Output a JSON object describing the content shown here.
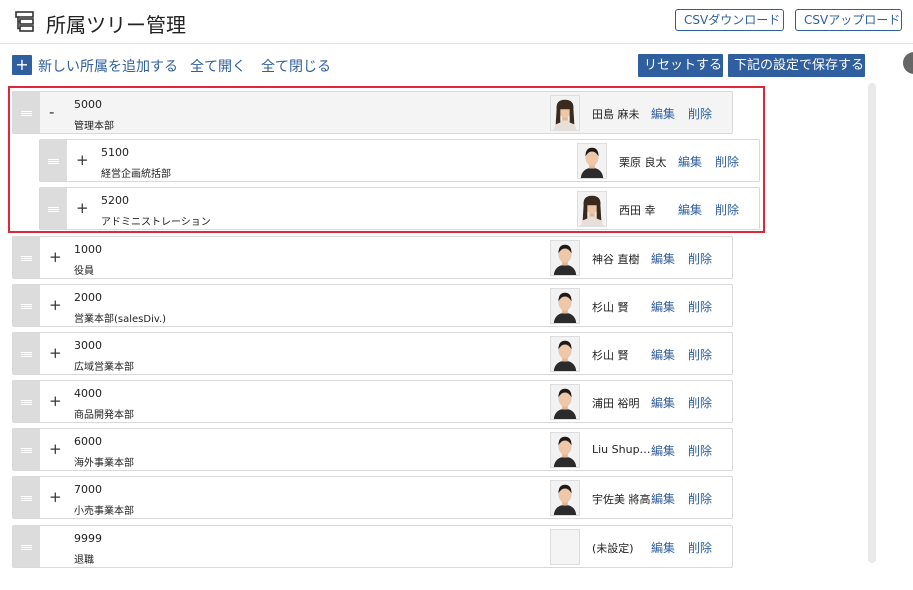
{
  "header": {
    "title": "所属ツリー管理",
    "csv_download": "CSVダウンロード",
    "csv_upload": "CSVアップロード"
  },
  "toolbar": {
    "add_icon": "+",
    "add_label": "新しい所属を追加する",
    "expand_all": "全て開く",
    "collapse_all": "全て閉じる",
    "reset": "リセットする",
    "save": "下記の設定で保存する"
  },
  "colors": {
    "accent": "#2f5f9e",
    "highlight": "#e0263a"
  },
  "actions": {
    "edit": "編集",
    "delete": "削除"
  },
  "tree": [
    {
      "code": "5000",
      "name": "管理本部",
      "toggle": "-",
      "manager": "田島 麻未",
      "avatar": "female-photo"
    },
    {
      "code": "5100",
      "name": "経営企画統括部",
      "toggle": "+",
      "manager": "栗原 良太",
      "avatar": "male-photo"
    },
    {
      "code": "5200",
      "name": "アドミニストレーション",
      "toggle": "+",
      "manager": "西田 幸",
      "avatar": "female-photo"
    },
    {
      "code": "1000",
      "name": "役員",
      "toggle": "+",
      "manager": "神谷 直樹",
      "avatar": "male-photo"
    },
    {
      "code": "2000",
      "name": "営業本部(salesDiv.)",
      "toggle": "+",
      "manager": "杉山 賢",
      "avatar": "male-photo"
    },
    {
      "code": "3000",
      "name": "広域営業本部",
      "toggle": "+",
      "manager": "杉山 賢",
      "avatar": "male-photo"
    },
    {
      "code": "4000",
      "name": "商品開発本部",
      "toggle": "+",
      "manager": "浦田 裕明",
      "avatar": "male-photo"
    },
    {
      "code": "6000",
      "name": "海外事業本部",
      "toggle": "+",
      "manager": "Liu Shup…",
      "avatar": "male-photo"
    },
    {
      "code": "7000",
      "name": "小売事業本部",
      "toggle": "+",
      "manager": "宇佐美 將高",
      "avatar": "male-photo"
    },
    {
      "code": "9999",
      "name": "退職",
      "toggle": "",
      "manager": "(未設定)",
      "avatar": "empty"
    }
  ]
}
